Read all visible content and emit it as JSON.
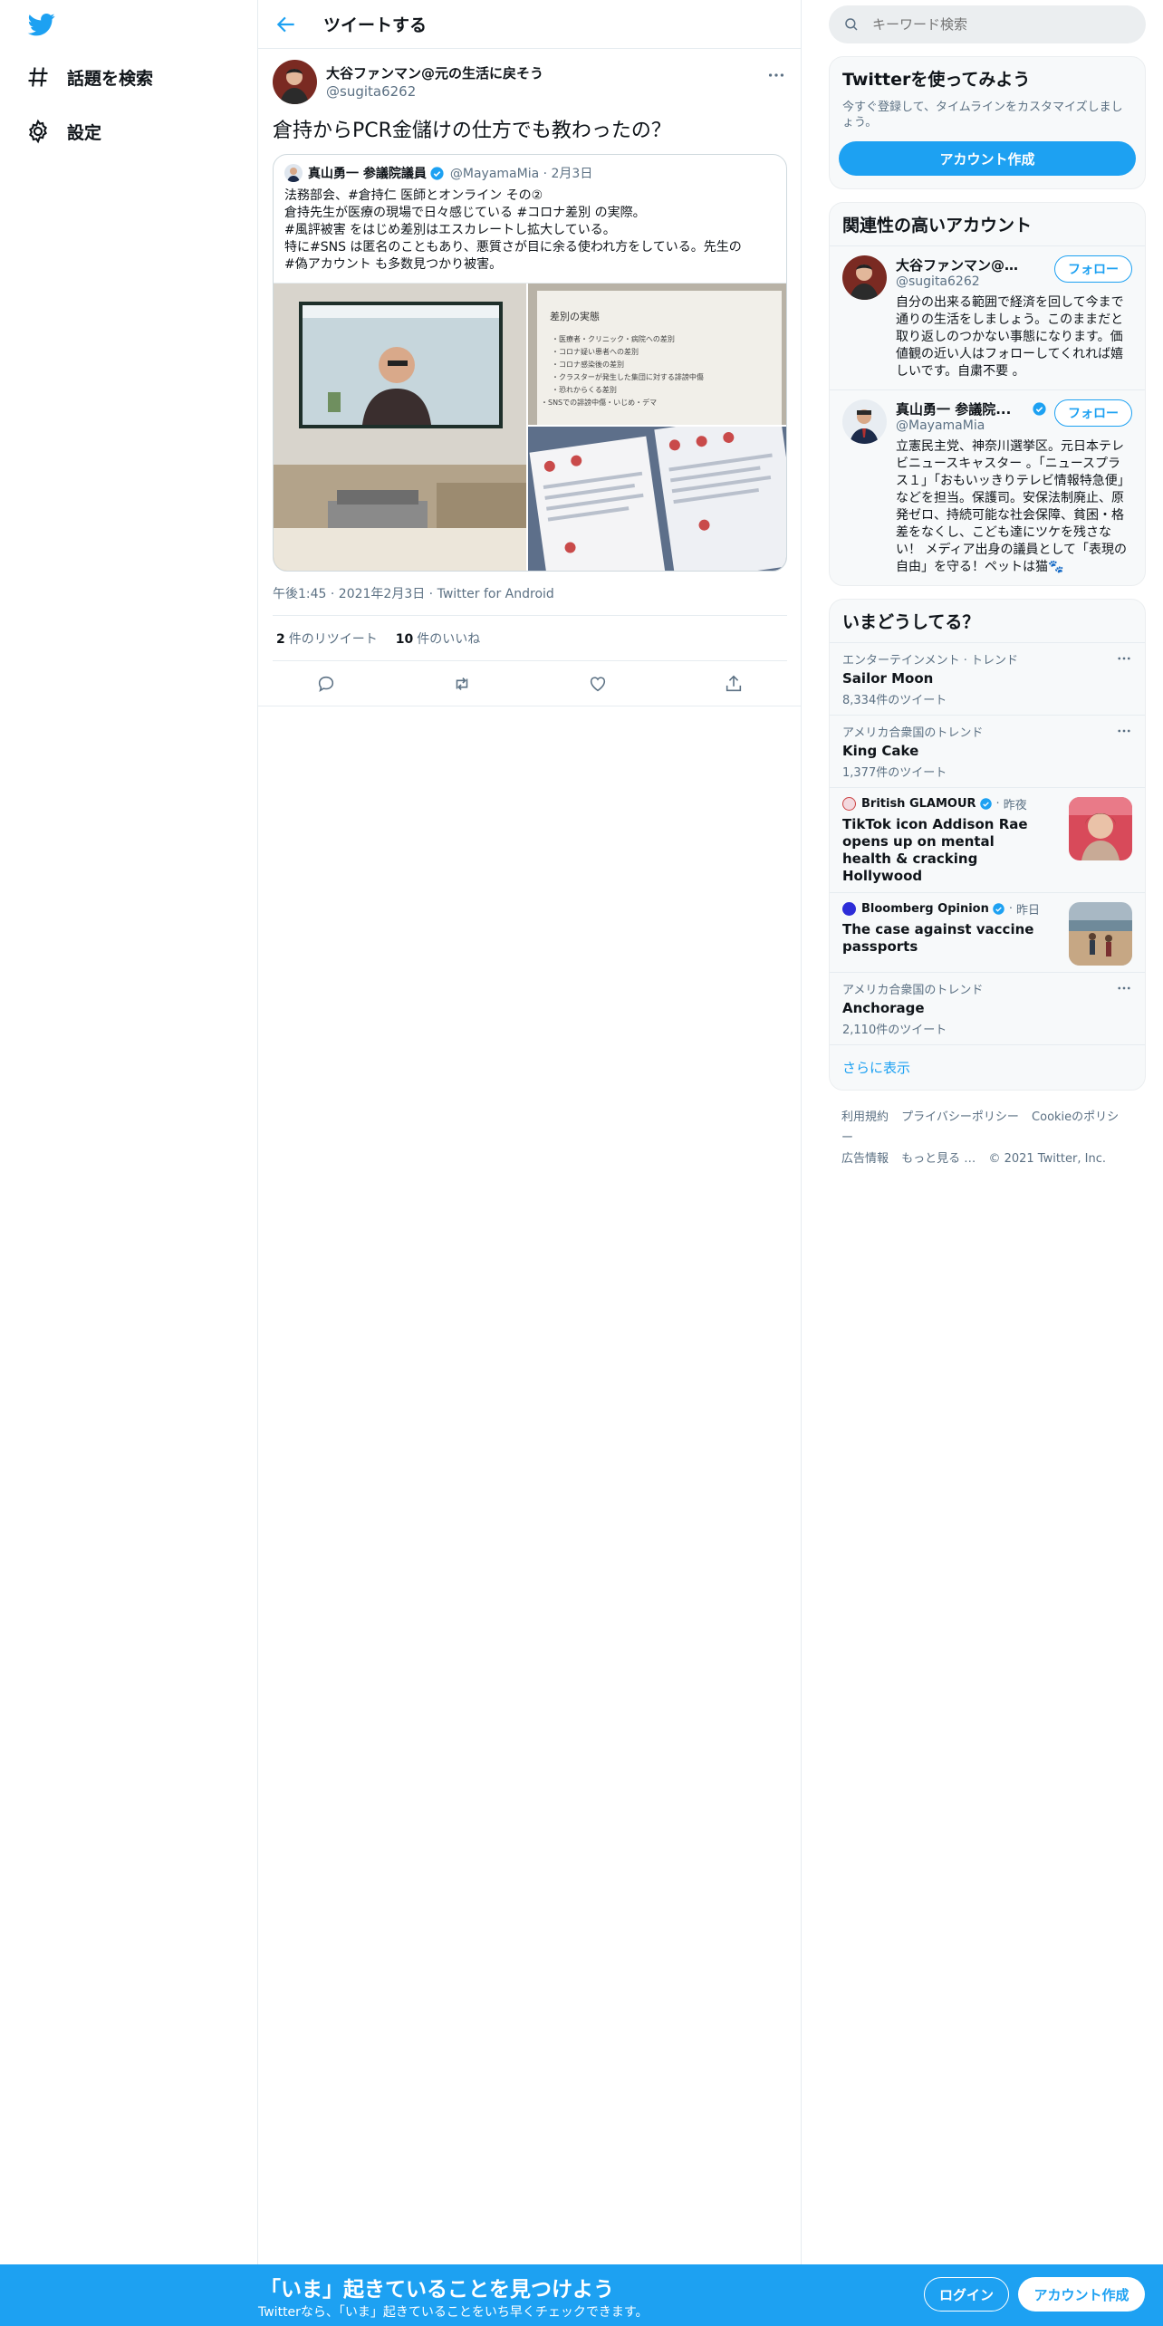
{
  "colors": {
    "brand": "#1da1f2",
    "text": "#0f1419",
    "muted": "#5b7083",
    "border": "#e6ecf0"
  },
  "nav": {
    "logo_icon": "twitter-bird-icon",
    "items": [
      {
        "label": "話題を検索",
        "icon": "hashtag-icon"
      },
      {
        "label": "設定",
        "icon": "gear-icon"
      }
    ]
  },
  "header": {
    "title": "ツイートする"
  },
  "tweet": {
    "author_name": "大谷ファンマン@元の生活に戻そう",
    "author_handle": "@sugita6262",
    "text": "倉持からPCR金儲けの仕方でも教わったの？",
    "quote": {
      "name": "真山勇一 参議院議員",
      "handle": "@MayamaMia · 2月3日",
      "body": "法務部会、#倉持仁 医師とオンライン その②\n倉持先生が医療の現場で日々感じている #コロナ差別 の実際。\n#風評被害 をはじめ差別はエスカレートし拡大している。\n特に#SNS は匿名のこともあり、悪質さが目に余る使われ方をしている。先生の\n#偽アカウント も多数見つかり被害。",
      "slide": {
        "title": "差別の実態",
        "lines": [
          "・医療者・クリニック・病院への差別",
          "・コロナ疑い患者への差別",
          "・コロナ感染後の差別",
          "・クラスターが発生した集団に対する誹謗中傷",
          "・恐れからくる差別",
          "・SNSでの誹謗中傷・いじめ・デマ"
        ]
      }
    },
    "meta": "午後1:45 · 2021年2月3日 · Twitter for Android",
    "retweets_count": "2",
    "retweets_label": "件のリツイート",
    "likes_count": "10",
    "likes_label": "件のいいね"
  },
  "search": {
    "placeholder": "キーワード検索"
  },
  "signup": {
    "title": "Twitterを使ってみよう",
    "sub": "今すぐ登録して、タイムラインをカスタマイズしましょう。",
    "button": "アカウント作成"
  },
  "suggest": {
    "title": "関連性の高いアカウント",
    "follow_label": "フォロー",
    "accounts": [
      {
        "name": "大谷ファンマン@元...",
        "handle": "@sugita6262",
        "bio": "自分の出来る範囲で経済を回して今まで通りの生活をしましょう。このままだと取り返しのつかない事態になります。価値観の近い人はフォローしてくれれば嬉しいです。自粛不要 。"
      },
      {
        "name": "真山勇一 参議院...",
        "handle": "@MayamaMia",
        "bio": "立憲民主党、神奈川選挙区。元日本テレビニュースキャスター 。「ニュースプラス１」「おもいッきりテレビ情報特急便」などを担当。保護司。安保法制廃止、原発ゼロ、持続可能な社会保障、貧困・格差をなくし、こども達にツケを残さない！ メディア出身の議員として「表現の自由」を守る！ペットは猫🐾"
      }
    ]
  },
  "trends": {
    "title": "いまどうしてる？",
    "items": [
      {
        "meta": "エンターテインメント · トレンド",
        "name": "Sailor Moon",
        "count": "8,334件のツイート"
      },
      {
        "meta": "アメリカ合衆国のトレンド",
        "name": "King Cake",
        "count": "1,377件のツイート"
      },
      {
        "meta": "アメリカ合衆国のトレンド",
        "name": "Anchorage",
        "count": "2,110件のツイート"
      }
    ],
    "news": [
      {
        "source": "British GLAMOUR",
        "time": "昨夜",
        "title": "TikTok icon Addison Rae opens up on mental health & cracking Hollywood"
      },
      {
        "source": "Bloomberg Opinion",
        "time": "昨日",
        "title": "The case against vaccine passports"
      }
    ],
    "show_more": "さらに表示"
  },
  "footer": {
    "links": [
      "利用規約",
      "プライバシーポリシー",
      "Cookieのポリシー",
      "広告情報",
      "もっと見る …",
      "© 2021 Twitter, Inc."
    ]
  },
  "bottom_bar": {
    "title": "「いま」起きていることを見つけよう",
    "sub": "Twitterなら、「いま」起きていることをいち早くチェックできます。",
    "login": "ログイン",
    "signup": "アカウント作成"
  }
}
